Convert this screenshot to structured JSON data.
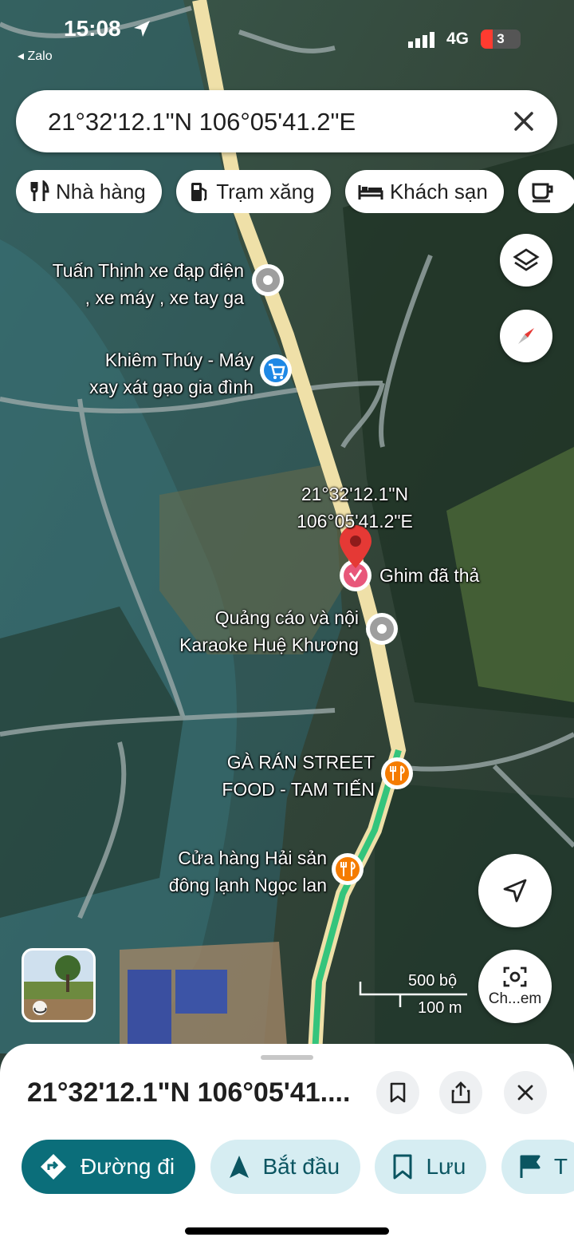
{
  "status_bar": {
    "time": "15:08",
    "back_app": "◂ Zalo",
    "network": "4G",
    "battery": "3"
  },
  "search": {
    "query": "21°32'12.1\"N 106°05'41.2\"E"
  },
  "chips": [
    {
      "label": "Nhà hàng",
      "icon": "fork-knife-icon"
    },
    {
      "label": "Trạm xăng",
      "icon": "gas-station-icon"
    },
    {
      "label": "Khách sạn",
      "icon": "bed-icon"
    },
    {
      "label": "",
      "icon": "coffee-icon"
    }
  ],
  "map": {
    "places": {
      "tuan_thinh": {
        "line1": "Tuấn Thịnh xe đạp điện",
        "line2": ", xe máy , xe tay ga"
      },
      "khiem_thuy": {
        "line1": "Khiêm Thúy - Máy",
        "line2": "xay xát gạo gia đình"
      },
      "pin_coords": {
        "line1": "21°32'12.1\"N",
        "line2": "106°05'41.2\"E"
      },
      "pin_label": "Ghim đã thả",
      "karaoke": {
        "line1": "Quảng cáo và nội",
        "line2": "Karaoke Huệ Khương"
      },
      "ga_ran": {
        "line1": "GÀ RÁN STREET",
        "line2": "FOOD - TAM TIẾN"
      },
      "hai_san": {
        "line1": "Cửa hàng Hải sản",
        "line2": "đông lạnh Ngọc lan"
      }
    },
    "scale": {
      "imperial": "500 bộ",
      "metric": "100 m"
    },
    "lens_label": "Ch...em",
    "colors": {
      "road": "#efe0a8",
      "route": "#34c47c",
      "pin": "#e53935",
      "food_marker": "#f57c00",
      "shop_marker": "#1e88e5"
    }
  },
  "sheet": {
    "title": "21°32'12.1\"N 106°05'41....",
    "actions": {
      "directions": "Đường đi",
      "start": "Bắt đầu",
      "save": "Lưu",
      "label": "T"
    }
  }
}
